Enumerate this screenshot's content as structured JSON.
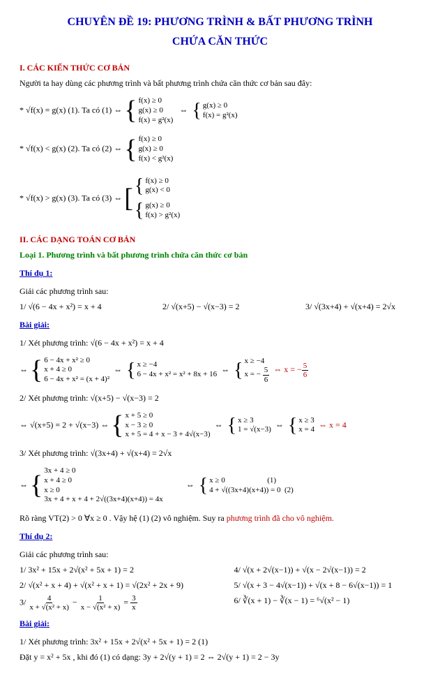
{
  "title": "CHUYÊN ĐỀ 19: PHƯƠNG TRÌNH & BẤT PHƯƠNG TRÌNH",
  "subtitle": "CHỨA CĂN THỨC",
  "s1": {
    "heading": "I. CÁC KIẾN THỨC CƠ BẢN",
    "intro": "Người ta hay dùng các phương trình và bất phương trình chứa căn thức cơ bản sau đây:",
    "r1": {
      "left": "* √f(x) = g(x) (1). Ta có (1) ⇔",
      "c1a": "f(x) ≥ 0",
      "c1b": "g(x) ≥ 0",
      "c1c": "f(x) = g²(x)",
      "mid": "⇔",
      "c2a": "g(x) ≥ 0",
      "c2b": "f(x) = g²(x)"
    },
    "r2": {
      "left": "* √f(x) < g(x)  (2). Ta có (2) ⇔",
      "c1a": "f(x) ≥ 0",
      "c1b": "g(x) ≥ 0",
      "c1c": "f(x) < g²(x)"
    },
    "r3": {
      "left": "* √f(x) > g(x)  (3). Ta có (3) ⇔",
      "c1a": "f(x) ≥ 0",
      "c1b": "g(x) < 0",
      "c2a": "g(x) ≥ 0",
      "c2b": "f(x) > g²(x)"
    }
  },
  "s2": {
    "heading": "II. CÁC DẠNG TOÁN CƠ BẢN",
    "loai1": "Loại 1. Phương trình và bất phương trình chứa căn thức cơ bản",
    "td1": "Thí dụ 1:",
    "giai": "Giải các phương trình sau:",
    "r1": {
      "a": "1/ √(6 − 4x + x²) = x + 4",
      "b": "2/ √(x+5) − √(x−3) = 2",
      "c": "3/ √(3x+4) + √(x+4) = 2√x"
    },
    "bg": "Bài giải:",
    "x1": {
      "intro": "1/ Xét phương trình:  √(6 − 4x + x²) = x + 4",
      "l1a": "6 − 4x + x² ≥ 0",
      "l1b": "x + 4 ≥ 0",
      "l1c": "6 − 4x + x² = (x + 4)²",
      "mid": "⇔",
      "l2a": "x ≥ −4",
      "l2b": "6 − 4x + x² = x² + 8x + 16",
      "l3a": "x ≥ −4",
      "l3b": "x = −",
      "frac_n": "5",
      "frac_d": "6",
      "res": "⇔ x = −",
      "res_n": "5",
      "res_d": "6"
    },
    "x2": {
      "intro": "2/ Xét phương trình:  √(x+5) − √(x−3) = 2",
      "l1": "⇔ √(x+5) = 2 + √(x−3) ⇔",
      "c1a": "x + 5 ≥ 0",
      "c1b": "x − 3 ≥ 0",
      "c1c": "x + 5 = 4 + x − 3 + 4√(x−3)",
      "c2a": "x ≥ 3",
      "c2b": "1 = √(x−3)",
      "c3a": "x ≥ 3",
      "c3b": "x = 4",
      "res": "⇔ x = 4"
    },
    "x3": {
      "intro": "3/ Xét phương trình:  √(3x+4) + √(x+4) = 2√x",
      "l1a": "3x + 4 ≥ 0",
      "l1b": "x + 4 ≥ 0",
      "l1c": "x ≥ 0",
      "l1d": "3x + 4 + x + 4 + 2√((3x+4)(x+4)) = 4x",
      "l2a": "x ≥ 0",
      "l2b": "4 + √((3x+4)(x+4)) = 0",
      "n1": "(1)",
      "n2": "(2)",
      "concl_a": "Rõ ràng  VT(2) > 0  ∀x ≥ 0 . Vậy hệ (1) (2) vô nghiệm. Suy ra ",
      "concl_b": "phương trình đã cho vô nghiệm."
    },
    "td2": "Thí dụ 2:",
    "giai2": "Giải các phương trình sau:",
    "p2": {
      "a": "1/  3x² + 15x + 2√(x² + 5x + 1) = 2",
      "b": "4/  √(x + 2√(x−1)) + √(x − 2√(x−1)) = 2",
      "c": "2/  √(x² + x + 4) + √(x² + x + 1) = √(2x² + 2x + 9)",
      "d": "5/  √(x + 3 − 4√(x−1)) + √(x + 8 − 6√(x−1)) = 1",
      "e_left": "3/  ",
      "e_n": "4",
      "e_d1": "x + √(x² + x)",
      "e_mid": " − ",
      "e_n2": "1",
      "e_d2": "x − √(x² + x)",
      "e_eq": " = ",
      "e_rn": "3",
      "e_rd": "x",
      "f": "6/  ∛(x + 1) − ∛(x − 1) = ⁶√(x² − 1)"
    },
    "bg2": "Bài giải:",
    "x2_1": {
      "a": "1/ Xét phương trình:  3x² + 15x + 2√(x² + 5x + 1) = 2  (1)",
      "b": "Đặt  y = x² + 5x , khi đó (1) có dạng:  3y + 2√(y + 1) = 2 ⇔ 2√(y + 1) = 2 − 3y"
    }
  }
}
